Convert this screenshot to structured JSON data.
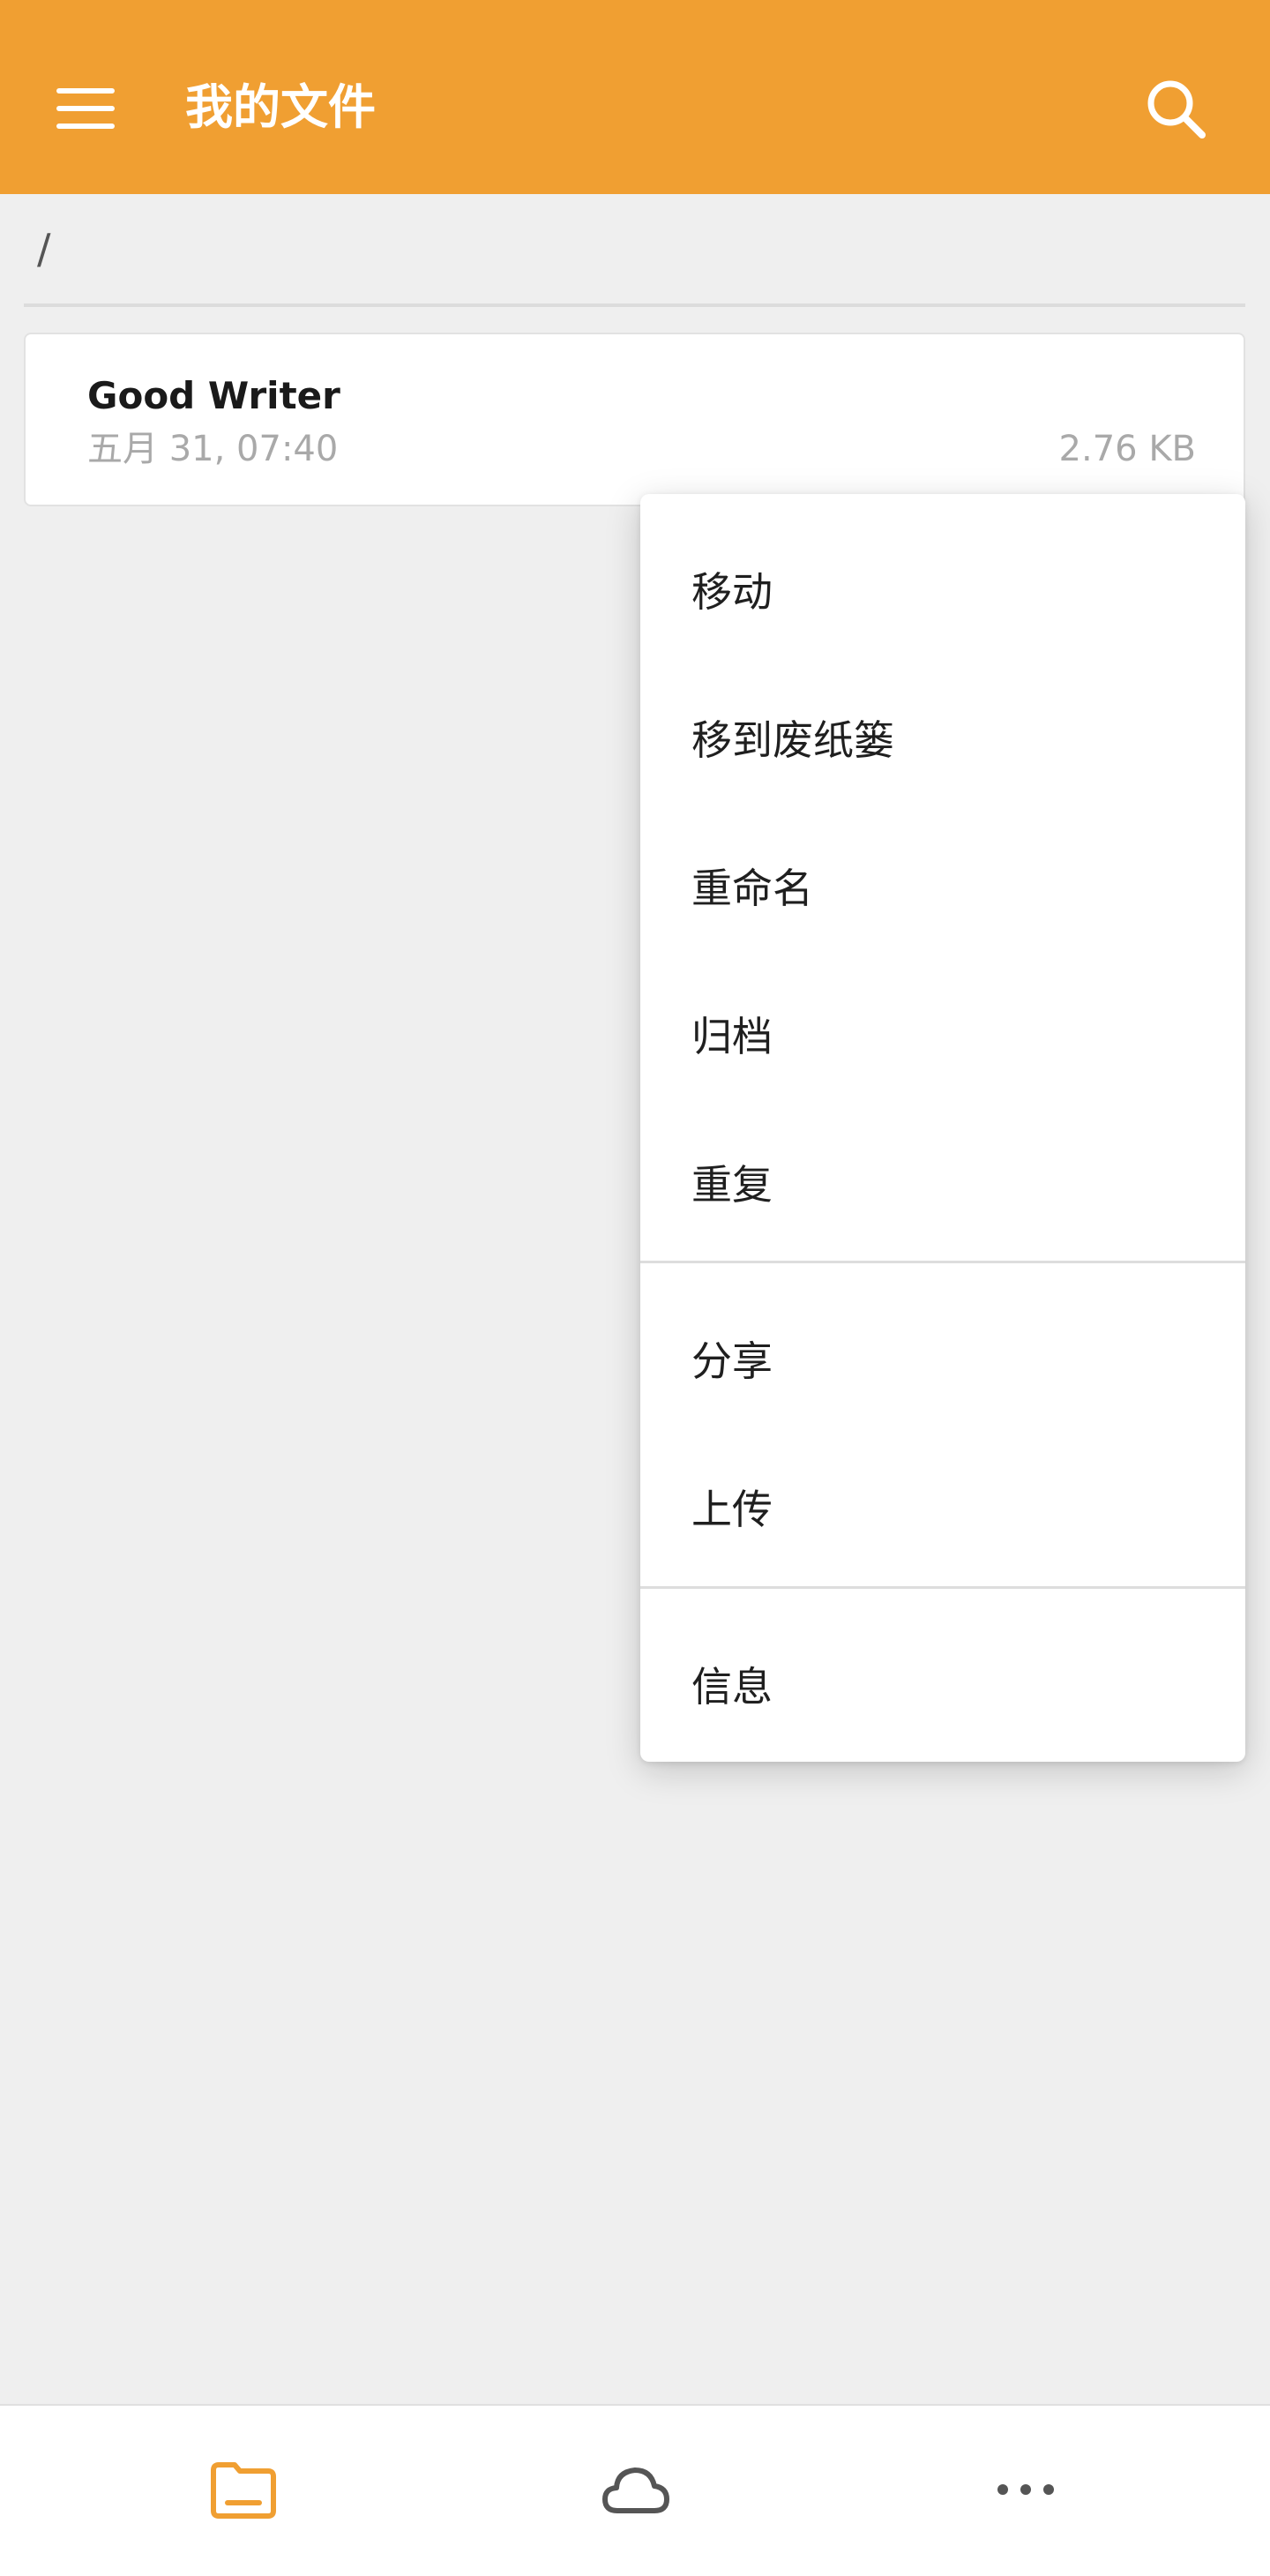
{
  "appbar": {
    "title": "我的文件",
    "menu_icon": "hamburger-menu-icon",
    "search_icon": "search-icon",
    "color": "#f09f32"
  },
  "breadcrumb": {
    "path": "/"
  },
  "files": [
    {
      "name": "Good Writer",
      "date": "五月 31, 07:40",
      "size": "2.76 KB"
    }
  ],
  "context_menu": {
    "groups": [
      [
        "移动",
        "移到废纸篓",
        "重命名",
        "归档",
        "重复"
      ],
      [
        "分享",
        "上传"
      ],
      [
        "信息"
      ]
    ]
  },
  "bottom_nav": {
    "items": [
      {
        "icon": "folder-icon",
        "active": true
      },
      {
        "icon": "cloud-icon",
        "active": false
      },
      {
        "icon": "more-horizontal-icon",
        "active": false
      }
    ],
    "active_color": "#f09f32",
    "inactive_color": "#555555"
  }
}
